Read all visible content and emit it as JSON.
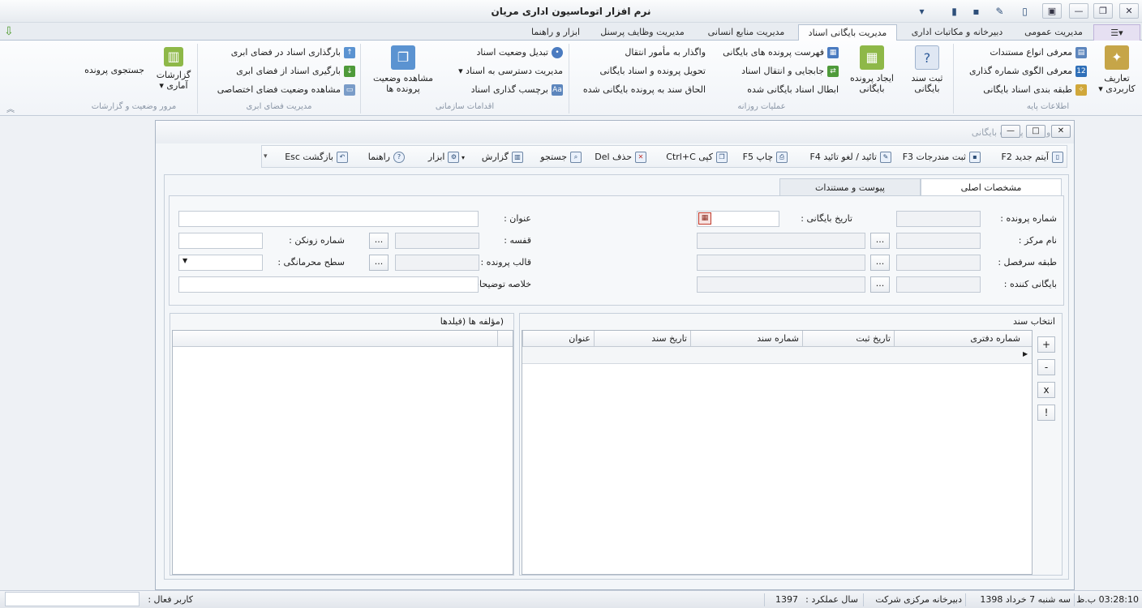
{
  "app": {
    "title": "نرم افزار اتوماسیون اداری مریان"
  },
  "tabs": [
    {
      "label": "مدیریت عمومی"
    },
    {
      "label": "دبیرخانه و مکاتبات اداری"
    },
    {
      "label": "مدیریت بایگانی اسناد"
    },
    {
      "label": "مدیریت منابع انسانی"
    },
    {
      "label": "مدیریت وظایف پرسنل"
    },
    {
      "label": "ابزار و راهنما"
    }
  ],
  "ribbon": {
    "groups": {
      "base_info": "اطلاعات پایه",
      "daily_ops": "عملیات روزانه",
      "org_actions": "اقدامات سازمانی",
      "cloud": "مدیریت فضای ابری",
      "reports": "مرور وضعیت و گزارشات"
    },
    "user_definitions": "تعاریف کاربردی",
    "base_items": [
      "معرفی انواع مستندات",
      "معرفی الگوی شماره گذاری",
      "طبقه بندی اسناد بایگانی"
    ],
    "register_doc": "ثبت سند بایگانی",
    "create_file": "ایجاد پرونده بایگانی",
    "daily_items_col1": [
      "فهرست پرونده های بایگانی",
      "جابجایی و انتقال اسناد",
      "ابطال اسناد بایگانی شده"
    ],
    "daily_items_col2": [
      "واگذار به مأمور انتقال",
      "تحویل پرونده و اسناد بایگانی",
      "الحاق سند به پرونده بایگانی شده"
    ],
    "org_items": [
      "تبدیل وضعیت اسناد",
      "مدیریت دسترسی به اسناد",
      "برچسب گذاری اسناد"
    ],
    "view_file_status": "مشاهده وضعیت پرونده ها",
    "cloud_items": [
      "بارگذاری اسناد در فضای ابری",
      "بارگیری اسناد از فضای ابری",
      "مشاهده وضعیت فضای اختصاصی"
    ],
    "stat_reports": "گزارشات آماری",
    "search_file": "جستجوی پرونده"
  },
  "child": {
    "title": "ثبت و ایجاد پرونده بایگانی",
    "toolbar": {
      "new": "آیتم جدید F2",
      "save": "ثبت مندرجات F3",
      "confirm": "تائید / لغو تائید F4",
      "print": "چاپ F5",
      "copy": "کپی Ctrl+C",
      "delete": "حذف Del",
      "search": "جستجو",
      "report": "گزارش",
      "tools": "ابزار",
      "help": "راهنما",
      "back": "بازگشت Esc"
    },
    "tabs": {
      "main": "مشخصات اصلی",
      "attachments": "پیوست و مستندات"
    },
    "form": {
      "file_number": "شماره پرونده :",
      "archive_date": "تاریخ بایگانی :",
      "title": "عنوان :",
      "center_name": "نام مرکز :",
      "shelf": "قفسه :",
      "binder_number": "شماره زونکن :",
      "category": "طبقه سرفصل :",
      "file_template": "قالب پرونده :",
      "confidentiality": "سطح محرمانگی :",
      "archiver": "بایگانی کننده :",
      "summary": "خلاصه توضیحات :"
    },
    "doc_select": {
      "title": "انتخاب سند",
      "columns": [
        "شماره دفتری",
        "تاریخ ثبت",
        "شماره سند",
        "تاریخ سند",
        "عنوان"
      ],
      "buttons": [
        "+",
        "-",
        "x",
        "!"
      ]
    },
    "components": {
      "title": "(مؤلفه ها (فیلدها"
    }
  },
  "status": {
    "time": "03:28:10 ب.ظ",
    "date": "سه شنبه 7 خرداد 1398",
    "office": "دبیرخانه مرکزی شرکت",
    "fiscal_label": "سال عملکرد :",
    "fiscal_year": "1397",
    "active_user": "کاربر فعال :"
  },
  "colors": {
    "accent": "#4a7bc0",
    "active_tab": "#fdfdfe",
    "background": "#eef1f5"
  }
}
